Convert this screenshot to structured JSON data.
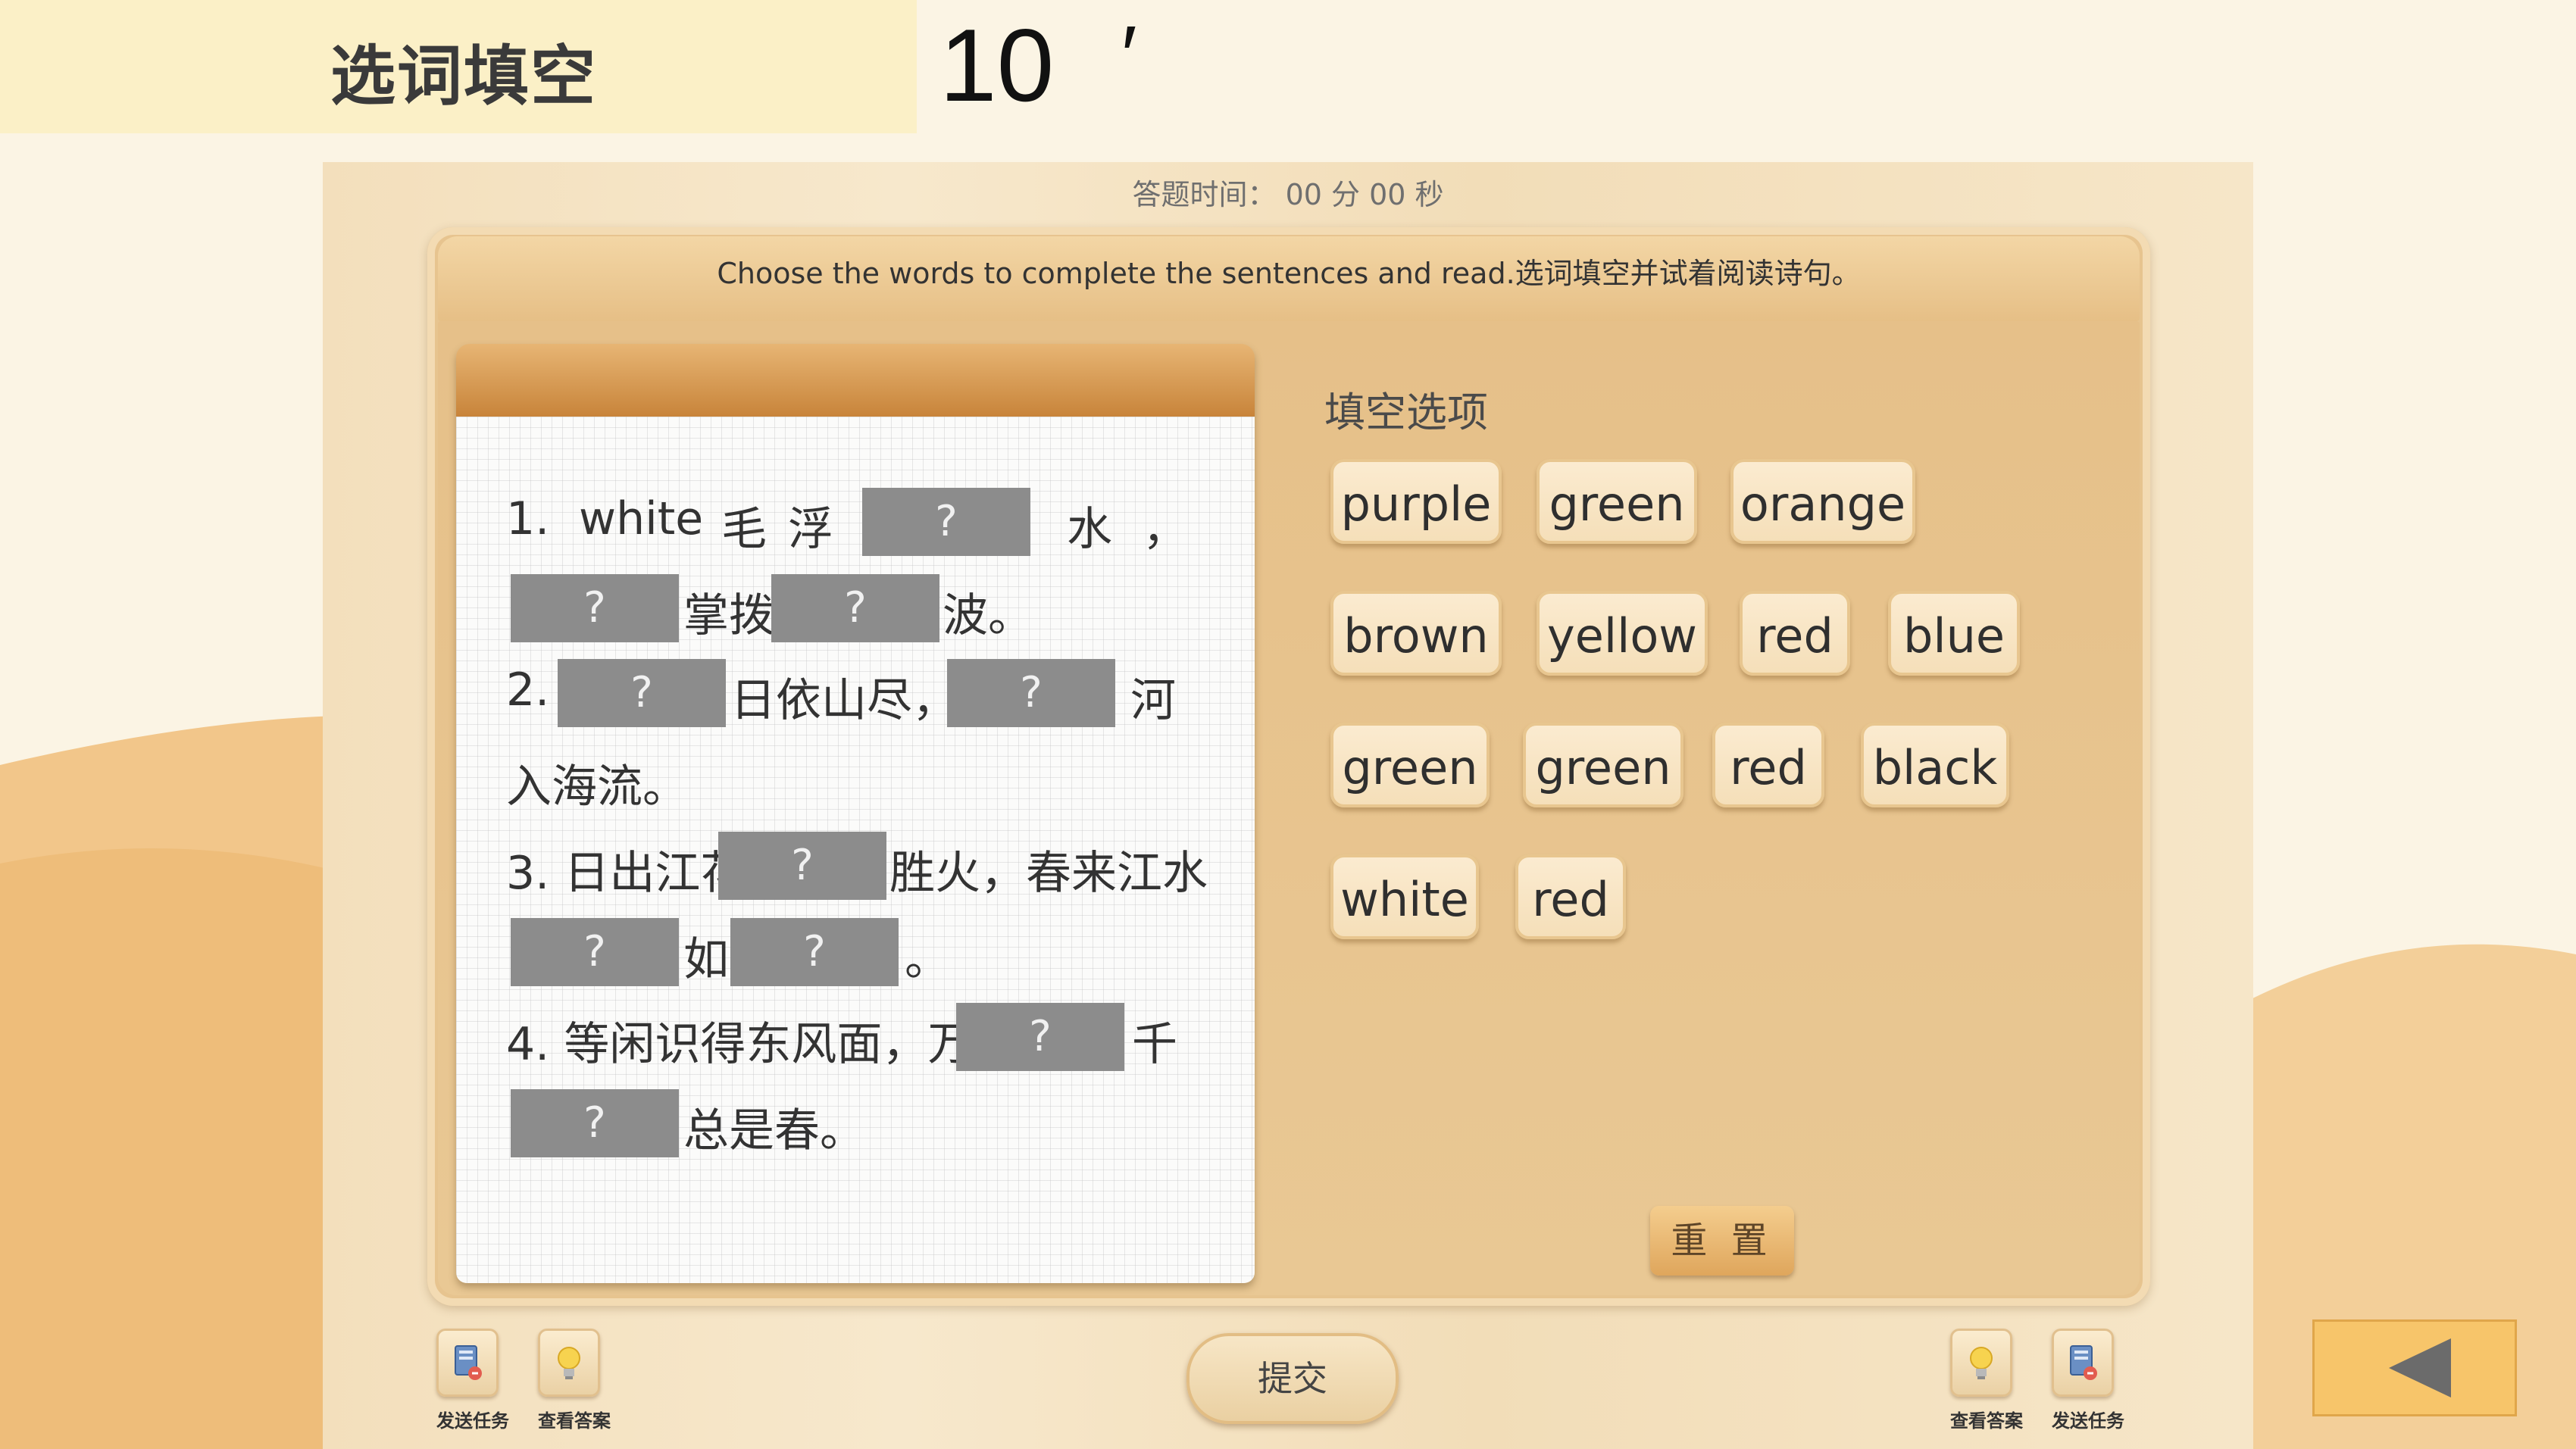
{
  "header": {
    "title": "选词填空",
    "timer_value": "10",
    "timer_unit": "′"
  },
  "app": {
    "answer_time": "答题时间： 00 分 00 秒",
    "instruction": "Choose the words to complete the sentences and read.选词填空并试着阅读诗句。",
    "poem": {
      "blank_label": "?",
      "l1": {
        "num": "1.",
        "w": "white",
        "a": "毛",
        "b": "浮",
        "c": "水",
        "d": "，"
      },
      "l2": {
        "a": "掌拨",
        "b": "波。"
      },
      "l3": {
        "num": "2.",
        "a": "日依山尽，",
        "b": "河"
      },
      "l4": {
        "a": "入海流。"
      },
      "l5": {
        "a": "3. 日出江花",
        "b": "胜火，春来江水"
      },
      "l6": {
        "a": "如",
        "b": "。"
      },
      "l7": {
        "a": "4. 等闲识得东风面，万",
        "b": "千"
      },
      "l8": {
        "a": "总是春。"
      }
    },
    "options_title": "填空选项",
    "options": [
      "purple",
      "green",
      "orange",
      "brown",
      "yellow",
      "red",
      "blue",
      "green",
      "green",
      "red",
      "black",
      "white",
      "red"
    ],
    "reset_label": "重 置",
    "submit_label": "提交",
    "tools": {
      "send_task_left": "发送任务",
      "view_answer_left": "查看答案",
      "view_answer_right": "查看答案",
      "send_task_right": "发送任务"
    }
  },
  "colors": {
    "blank_fill": "#8c8c8c",
    "frame": "#e7c48f",
    "back_button": "#f7c56a"
  },
  "icons": [
    "send-task-icon",
    "lightbulb-icon",
    "back-arrow-icon"
  ]
}
